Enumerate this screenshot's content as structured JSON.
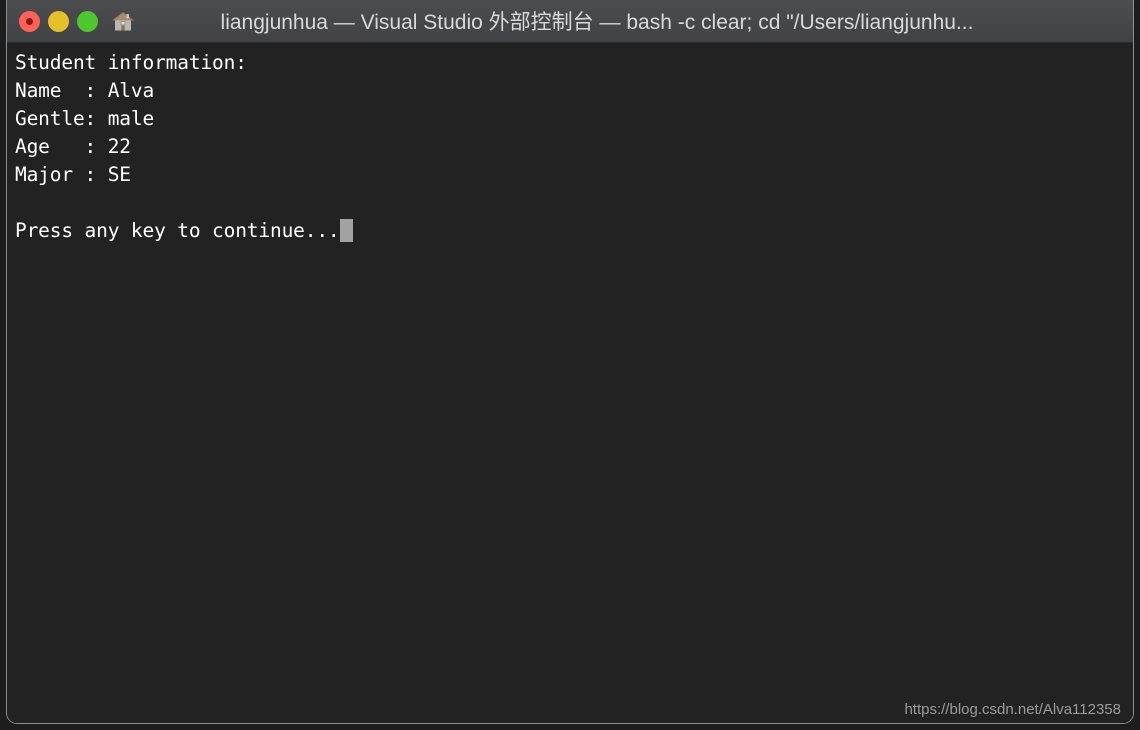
{
  "window": {
    "titlebar": {
      "title": "liangjunhua — Visual Studio 外部控制台 — bash -c clear; cd \"/Users/liangjunhu...",
      "close_label": "Close",
      "minimize_label": "Minimize",
      "maximize_label": "Maximize",
      "home_icon": "house-icon"
    },
    "colors": {
      "titlebar_bg": "#474849",
      "terminal_bg": "#222222",
      "terminal_text": "#ffffff",
      "cursor": "#a2a2a2",
      "close_button": "#ff6159",
      "minimize_button": "#e6c029",
      "maximize_button": "#4fc630",
      "window_border": "#8d8d8d",
      "watermark_text": "#9b9b9b"
    }
  },
  "terminal": {
    "lines": [
      "Student information:",
      "Name  : Alva",
      "Gentle: male",
      "Age   : 22",
      "Major : SE",
      "",
      "Press any key to continue..."
    ],
    "prompt_line_index": 6,
    "cursor_visible": true
  },
  "watermark": {
    "text": "https://blog.csdn.net/Alva112358"
  }
}
